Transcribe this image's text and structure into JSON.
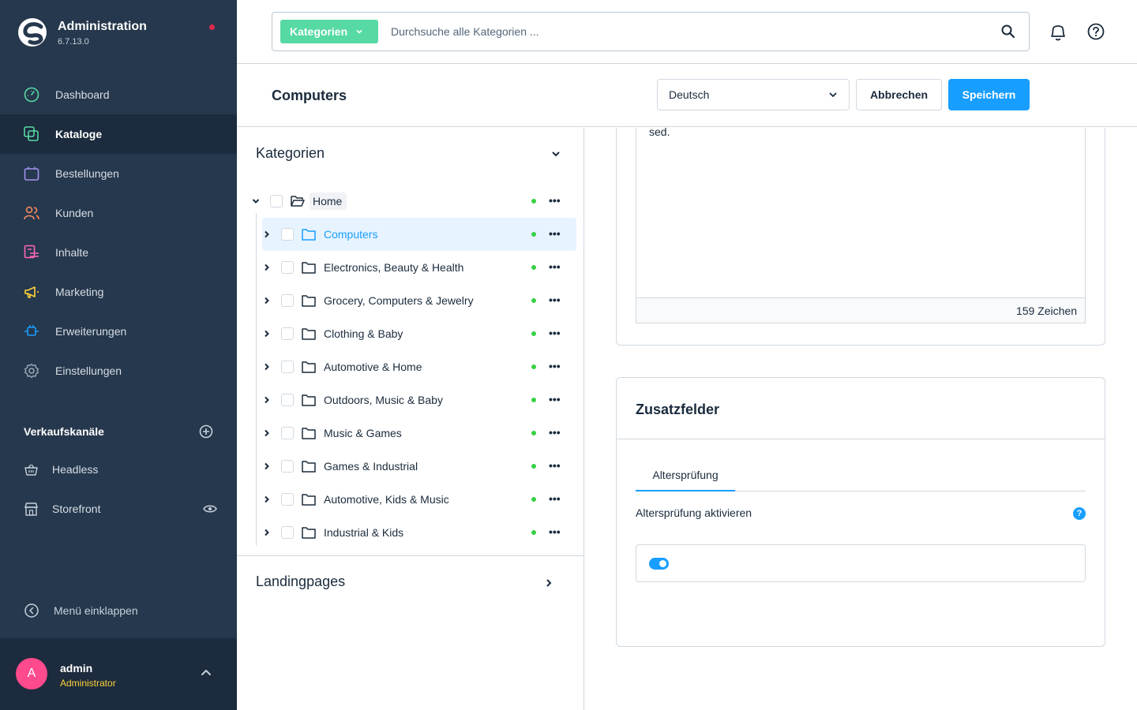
{
  "app": {
    "title": "Administration",
    "version": "6.7.13.0"
  },
  "nav": {
    "items": [
      {
        "label": "Dashboard",
        "icon": "dashboard-icon",
        "color": "#57d9a3"
      },
      {
        "label": "Kataloge",
        "icon": "catalog-icon",
        "color": "#57d9a3",
        "active": true
      },
      {
        "label": "Bestellungen",
        "icon": "orders-icon",
        "color": "#a092f0"
      },
      {
        "label": "Kunden",
        "icon": "customers-icon",
        "color": "#f88962"
      },
      {
        "label": "Inhalte",
        "icon": "content-icon",
        "color": "#ff68b4"
      },
      {
        "label": "Marketing",
        "icon": "marketing-icon",
        "color": "#ffd33b"
      },
      {
        "label": "Erweiterungen",
        "icon": "extensions-icon",
        "color": "#189eff"
      },
      {
        "label": "Einstellungen",
        "icon": "settings-icon",
        "color": "#9aa8b5"
      }
    ]
  },
  "sales_channels": {
    "title": "Verkaufskanäle",
    "items": [
      {
        "label": "Headless",
        "icon": "basket-icon"
      },
      {
        "label": "Storefront",
        "icon": "storefront-icon"
      }
    ]
  },
  "sidebar_footer": {
    "collapse_label": "Menü einklappen"
  },
  "user": {
    "initial": "A",
    "name": "admin",
    "role": "Administrator"
  },
  "search": {
    "type_label": "Kategorien",
    "placeholder": "Durchsuche alle Kategorien ..."
  },
  "page": {
    "title": "Computers",
    "language": "Deutsch",
    "cancel_label": "Abbrechen",
    "save_label": "Speichern"
  },
  "tree": {
    "title": "Kategorien",
    "root": "Home",
    "children": [
      {
        "label": "Computers",
        "selected": true
      },
      {
        "label": "Electronics, Beauty & Health"
      },
      {
        "label": "Grocery, Computers & Jewelry"
      },
      {
        "label": "Clothing & Baby"
      },
      {
        "label": "Automotive & Home"
      },
      {
        "label": "Outdoors, Music & Baby"
      },
      {
        "label": "Music & Games"
      },
      {
        "label": "Games & Industrial"
      },
      {
        "label": "Automotive, Kids & Music"
      },
      {
        "label": "Industrial & Kids"
      }
    ],
    "more_label": "•••",
    "landing_title": "Landingpages"
  },
  "description": {
    "text": "sed.",
    "char_count": "159 Zeichen"
  },
  "custom_fields": {
    "title": "Zusatzfelder",
    "tab": "Altersprüfung",
    "field_label": "Altersprüfung aktivieren",
    "help_label": "?",
    "toggle_on": true
  },
  "colors": {
    "sidebar": "#26384d",
    "accent": "#189eff",
    "search_type": "#57d9a3",
    "status_active": "#37d046"
  }
}
